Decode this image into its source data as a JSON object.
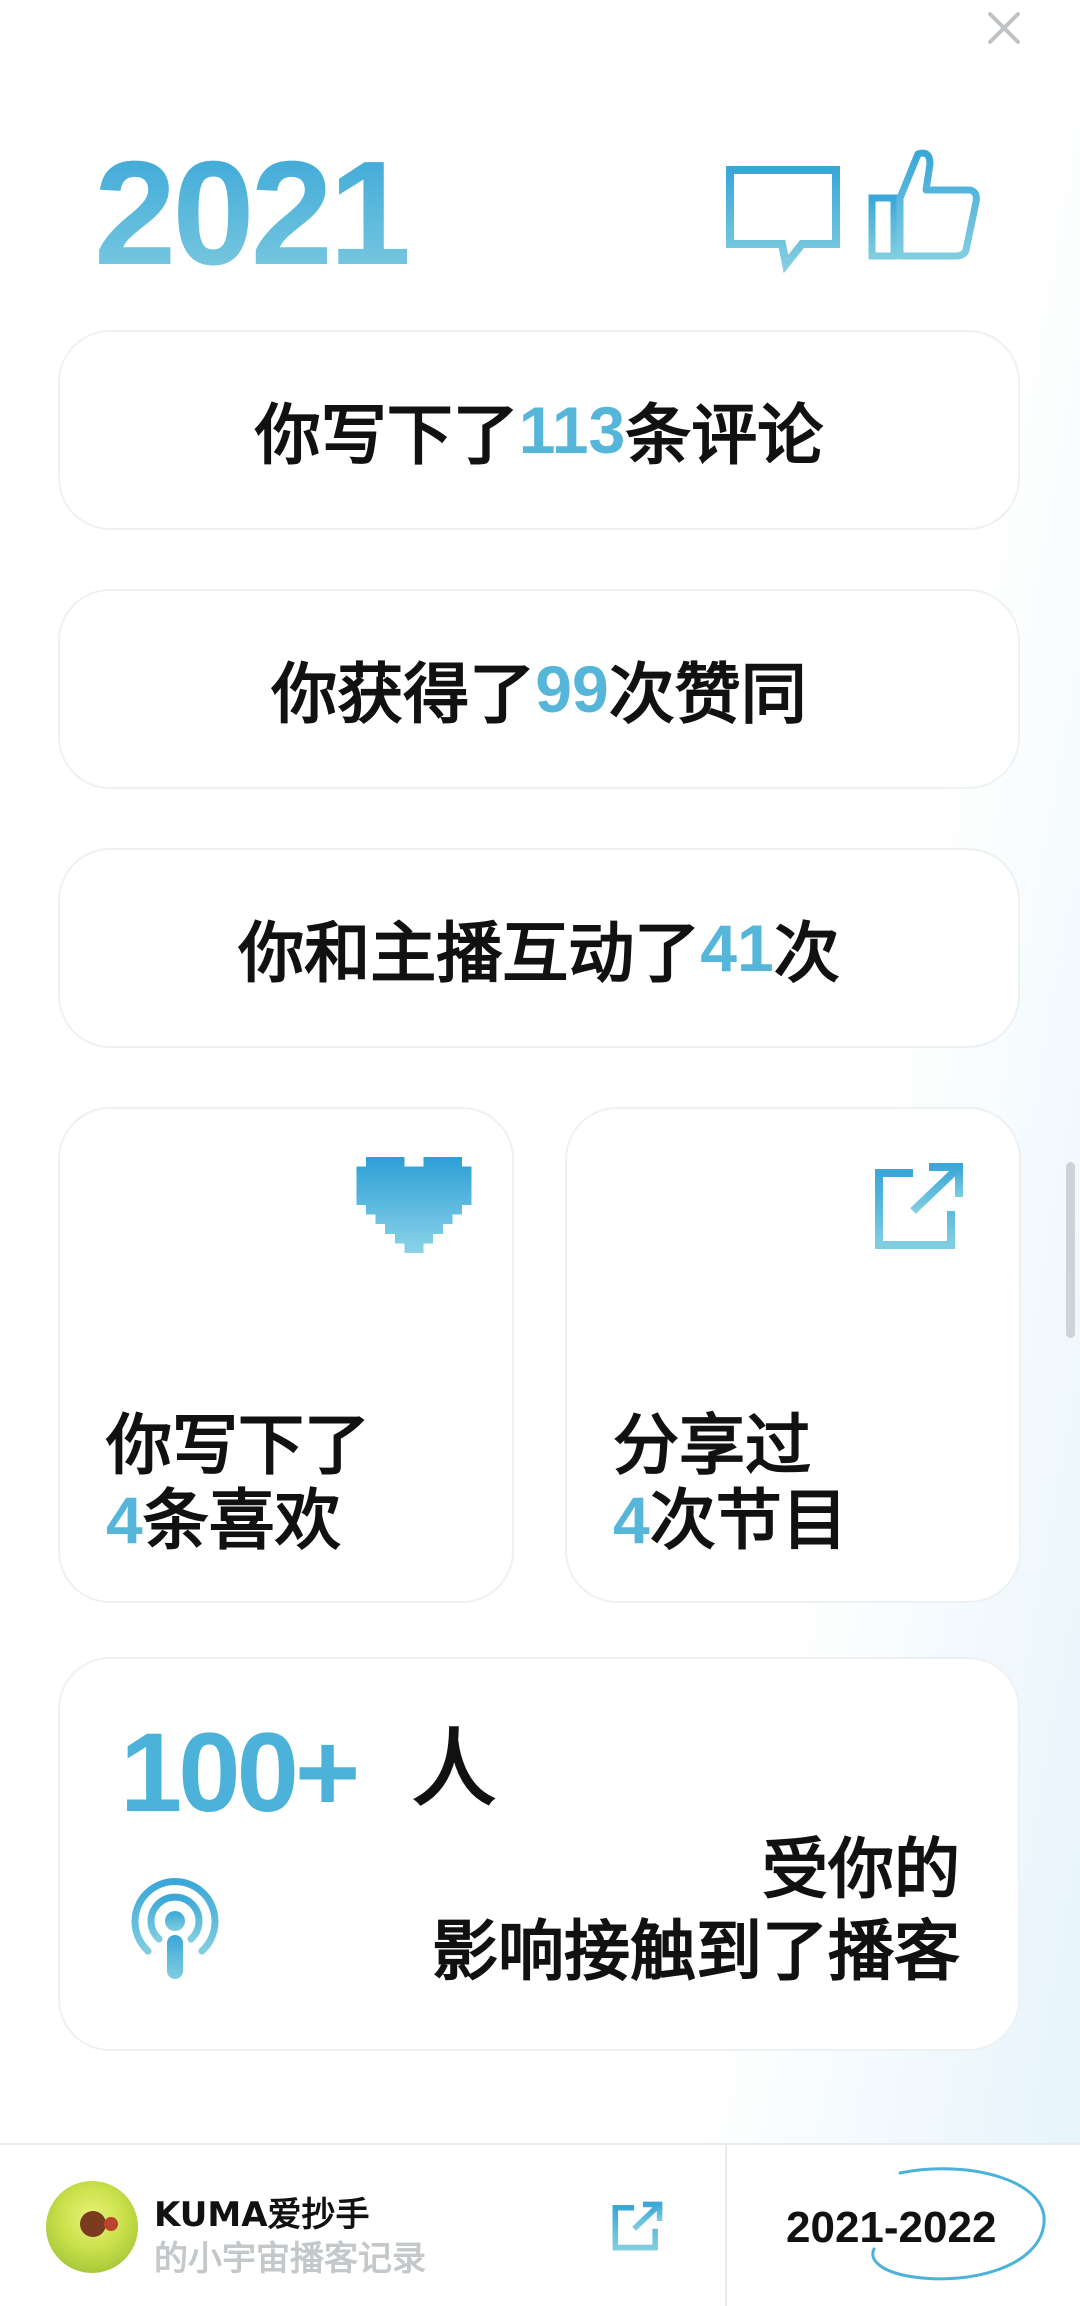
{
  "year": "2021",
  "stats": {
    "comments": {
      "pre": "你写下了",
      "num": "113",
      "post": "条评论"
    },
    "likes": {
      "pre": "你获得了",
      "num": "99",
      "post": "次赞同"
    },
    "interactions": {
      "pre": "你和主播互动了",
      "num": "41",
      "post": "次"
    }
  },
  "favorites": {
    "line1": "你写下了",
    "num": "4",
    "line2_post": "条喜欢"
  },
  "shares": {
    "line1": "分享过",
    "num": "4",
    "line2_post": "次节目"
  },
  "reach": {
    "num": "100+",
    "unit": "人",
    "line1": "受你的",
    "line2": "影响接触到了播客"
  },
  "footer": {
    "user_name": "KUMA爱抄手",
    "subtitle": "的小宇宙播客记录",
    "range": "2021-2022"
  },
  "colors": {
    "accent": "#56b6da",
    "text": "#111111",
    "muted": "#c4c8cb"
  }
}
